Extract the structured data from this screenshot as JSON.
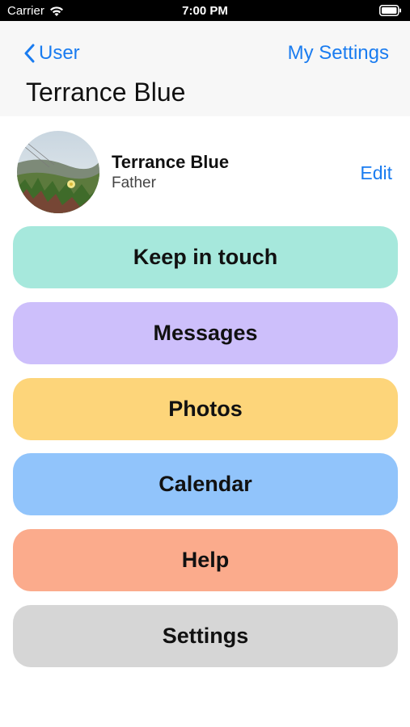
{
  "status_bar": {
    "carrier": "Carrier",
    "time": "7:00 PM",
    "wifi_icon": "wifi-icon",
    "battery_icon": "battery-icon"
  },
  "nav": {
    "back_label": "User",
    "back_icon": "chevron-left-icon",
    "right_label": "My Settings",
    "title": "Terrance Blue",
    "accent": "#1a7cf0"
  },
  "profile": {
    "name": "Terrance Blue",
    "role": "Father",
    "edit_label": "Edit"
  },
  "menu": [
    {
      "label": "Keep in touch",
      "color": "#a6e8dc"
    },
    {
      "label": "Messages",
      "color": "#cdbffb"
    },
    {
      "label": "Photos",
      "color": "#fdd57a"
    },
    {
      "label": "Calendar",
      "color": "#91c4fb"
    },
    {
      "label": "Help",
      "color": "#fbab8c"
    },
    {
      "label": "Settings",
      "color": "#d6d6d6"
    }
  ]
}
